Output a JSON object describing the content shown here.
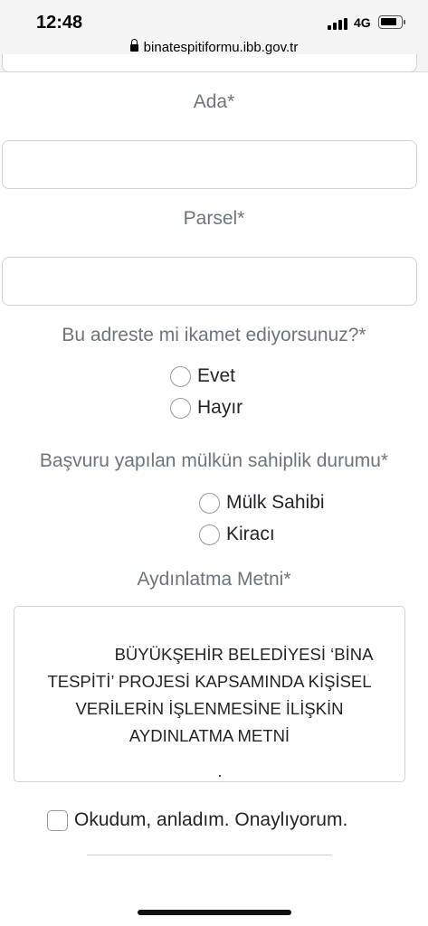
{
  "status_bar": {
    "time": "12:48",
    "network": "4G",
    "url": "binatespitiformu.ibb.gov.tr"
  },
  "form": {
    "ada": {
      "label": "Ada*",
      "value": ""
    },
    "parsel": {
      "label": "Parsel*",
      "value": ""
    },
    "residence": {
      "question": "Bu adreste mi ikamet ediyorsunuz?*",
      "options": [
        "Evet",
        "Hayır"
      ]
    },
    "ownership": {
      "question": "Başvuru yapılan mülkün sahiplik durumu*",
      "options": [
        "Mülk Sahibi",
        "Kiracı"
      ]
    },
    "notice": {
      "label": "Aydınlatma Metni*",
      "title": "BÜYÜKŞEHİR BELEDİYESİ ‘BİNA TESPİTİ’ PROJESİ KAPSAMINDA KİŞİSEL VERİLERİN İŞLENMESİNE İLİŞKİN AYDINLATMA METNİ"
    },
    "consent": {
      "label": "Okudum, anladım. Onaylıyorum.",
      "checked": false
    }
  }
}
